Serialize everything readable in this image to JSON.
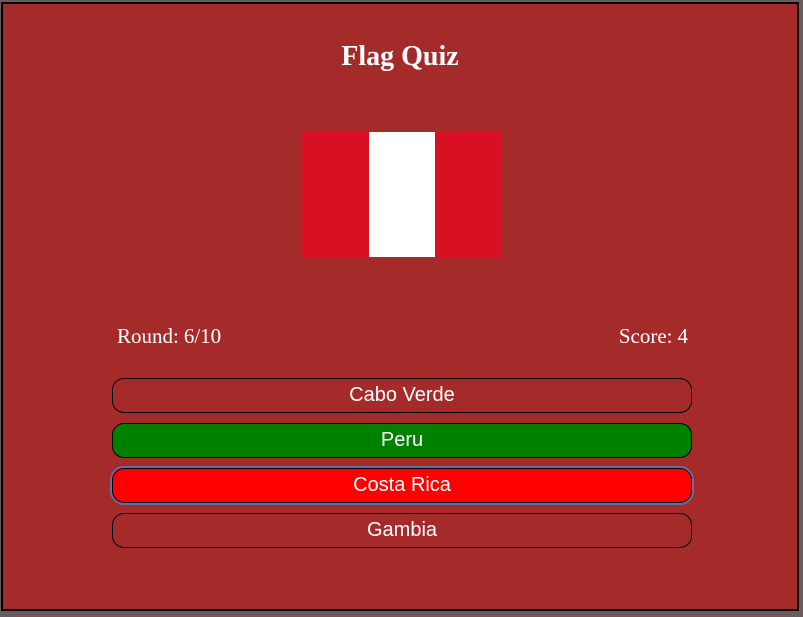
{
  "game": {
    "title": "Flag Quiz"
  },
  "flag": {
    "country_shown": "Peru",
    "stripes": [
      "#d91023",
      "#ffffff",
      "#d91023"
    ]
  },
  "stats": {
    "round_label": "Round:",
    "round_value": "6/10",
    "score_label": "Score:",
    "score_value": "4"
  },
  "answers": [
    {
      "label": "Cabo Verde",
      "state": "neutral",
      "color": "#a52a2a"
    },
    {
      "label": "Peru",
      "state": "correct",
      "color": "#008000"
    },
    {
      "label": "Costa Rica",
      "state": "wrong-selected",
      "color": "#ff0000"
    },
    {
      "label": "Gambia",
      "state": "neutral",
      "color": "#a52a2a"
    }
  ],
  "colors": {
    "background": "#a52a2a",
    "correct": "#008000",
    "wrong": "#ff0000"
  }
}
